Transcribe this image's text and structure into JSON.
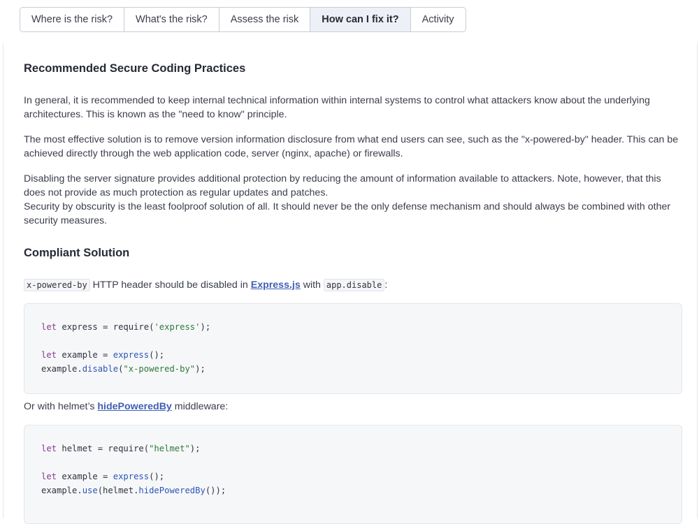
{
  "tabs": [
    {
      "label": "Where is the risk?",
      "active": false
    },
    {
      "label": "What's the risk?",
      "active": false
    },
    {
      "label": "Assess the risk",
      "active": false
    },
    {
      "label": "How can I fix it?",
      "active": true
    },
    {
      "label": "Activity",
      "active": false
    }
  ],
  "section1": {
    "title": "Recommended Secure Coding Practices",
    "p1": "In general, it is recommended to keep internal technical information within internal systems to control what attackers know about the underlying architectures. This is known as the \"need to know\" principle.",
    "p2": "The most effective solution is to remove version information disclosure from what end users can see, such as the \"x-powered-by\" header. This can be achieved directly through the web application code, server (nginx, apache) or firewalls.",
    "p3a": "Disabling the server signature provides additional protection by reducing the amount of information available to attackers. Note, however, that this does not provide as much protection as regular updates and patches.",
    "p3b": "Security by obscurity is the least foolproof solution of all. It should never be the only defense mechanism and should always be combined with other security measures."
  },
  "section2": {
    "title": "Compliant Solution",
    "intro_code1": "x-powered-by",
    "intro_text1": " HTTP header should be disabled in ",
    "intro_link": "Express.js",
    "intro_text2": " with ",
    "intro_code2": "app.disable",
    "intro_text3": ":",
    "helmet_text1": "Or with helmet’s ",
    "helmet_link": "hidePoweredBy",
    "helmet_text2": " middleware:"
  },
  "code1": {
    "l1_kw": "let",
    "l1_rest": " express = require(",
    "l1_str": "'express'",
    "l1_end": ");",
    "l2_kw": "let",
    "l2_rest": " example = ",
    "l2_fn": "express",
    "l2_end": "();",
    "l3_a": "example.",
    "l3_fn": "disable",
    "l3_b": "(",
    "l3_str": "\"x-powered-by\"",
    "l3_end": ");"
  },
  "code2": {
    "l1_kw": "let",
    "l1_rest": " helmet = require(",
    "l1_str": "\"helmet\"",
    "l1_end": ");",
    "l2_kw": "let",
    "l2_rest": " example = ",
    "l2_fn": "express",
    "l2_end": "();",
    "l3_a": "example.",
    "l3_fn": "use",
    "l3_b": "(helmet.",
    "l3_fn2": "hidePoweredBy",
    "l3_end": "());"
  }
}
